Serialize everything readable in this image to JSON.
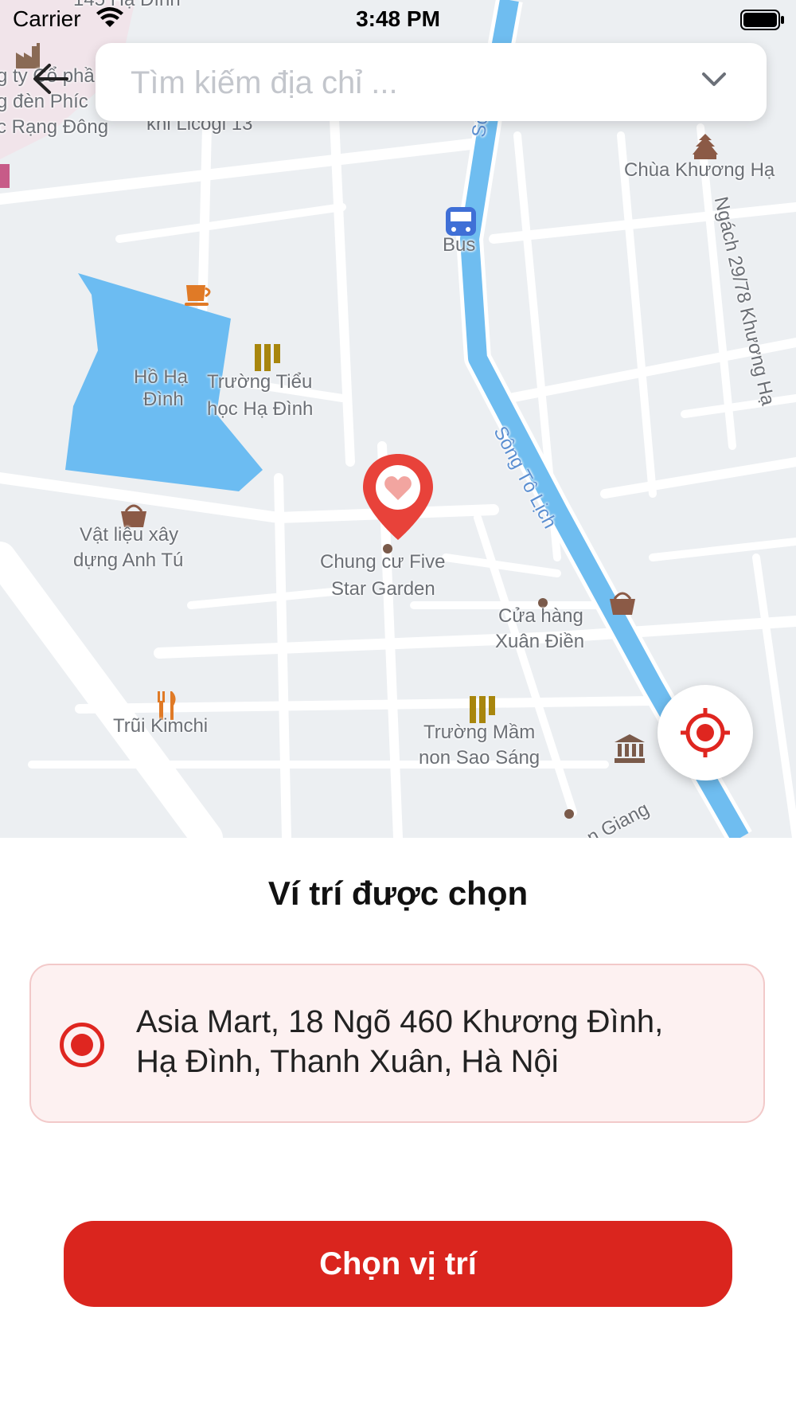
{
  "status_bar": {
    "carrier": "Carrier",
    "time": "3:48 PM"
  },
  "search": {
    "placeholder": "Tìm kiếm địa chỉ ..."
  },
  "map": {
    "labels": {
      "top_street": "145 Hạ Đình",
      "company_1": "g ty Cổ phầ",
      "company_2": "g đèn Phíc",
      "company_3": "c Rạng Đông",
      "licogi": "khi Licogi 13",
      "river_vertical": "Sông",
      "pagoda": "Chùa Khương Hạ",
      "bus": "Bus",
      "alley": "Ngách 29/78 Khương Hạ",
      "lake_1": "Hồ Hạ",
      "lake_2": "Đình",
      "school_1": "Trường Tiểu",
      "school_2": "học Hạ Đình",
      "river_diag": "Sông Tô Lịch",
      "material_1": "Vật liệu xây",
      "material_2": "dựng Anh Tú",
      "apartment_1": "Chung cư Five",
      "apartment_2": "Star Garden",
      "store_1": "Cửa hàng",
      "store_2": "Xuân Điền",
      "restaurant": "Trũi Kimchi",
      "kinder_1": "Trường Mầm",
      "kinder_2": "non Sao Sáng",
      "giang": "n Giang"
    }
  },
  "panel": {
    "title": "Ví trí được chọn",
    "address_line_1": "Asia Mart, 18 Ngõ 460 Khương Đình,",
    "address_line_2": "Hạ Đình, Thanh Xuân, Hà Nội",
    "confirm_label": "Chọn vị trí"
  },
  "colors": {
    "accent": "#da251e",
    "card_bg": "#fdf1f1",
    "card_border": "#f2c9c9",
    "river": "#6fbdf0",
    "lake": "#6cbcf2",
    "map_bg": "#eceff2"
  },
  "icons": [
    "back-arrow-icon",
    "chevron-down-icon",
    "map-pin-heart-icon",
    "locate-target-icon",
    "radio-selected-icon",
    "wifi-icon",
    "battery-icon"
  ]
}
